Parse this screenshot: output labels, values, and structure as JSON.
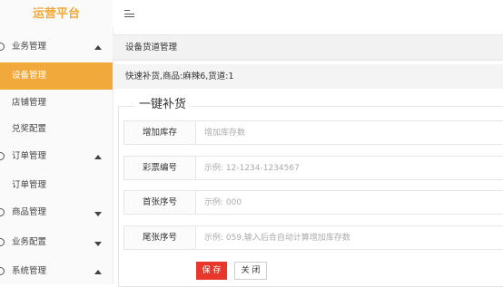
{
  "brand": "运营平台",
  "sidebar": {
    "items": [
      {
        "label": "业务管理",
        "kind": "group",
        "arrow": "up"
      },
      {
        "label": "设备管理",
        "kind": "sub",
        "active": true
      },
      {
        "label": "店铺管理",
        "kind": "sub"
      },
      {
        "label": "兑奖配置",
        "kind": "sub"
      },
      {
        "label": "订单管理",
        "kind": "group",
        "arrow": "up"
      },
      {
        "label": "订单管理",
        "kind": "sub"
      },
      {
        "label": "商品管理",
        "kind": "group",
        "arrow": "down"
      },
      {
        "label": "业务配置",
        "kind": "group",
        "arrow": "down"
      },
      {
        "label": "系统管理",
        "kind": "group",
        "arrow": "up"
      }
    ]
  },
  "tab": {
    "title": "设备货道管理"
  },
  "info": {
    "text": "快速补货,商品:麻辣6,货道:1"
  },
  "form": {
    "legend": "一键补货",
    "fields": [
      {
        "label": "增加库存",
        "placeholder": "增加库存数"
      },
      {
        "label": "彩票编号",
        "placeholder": "示例: 12-1234-1234567"
      },
      {
        "label": "首张序号",
        "placeholder": "示例: 000"
      },
      {
        "label": "尾张序号",
        "placeholder": "示例: 059,输入后合自动计算增加库存数"
      }
    ],
    "save_label": "保 存",
    "close_label": "关 闭"
  },
  "colors": {
    "accent": "#f2a93b",
    "save": "#e8382c"
  },
  "icons": {
    "menu_toggle": "hamburger-icon",
    "group": "circle-icon",
    "expand": "triangle-arrow-icon"
  }
}
